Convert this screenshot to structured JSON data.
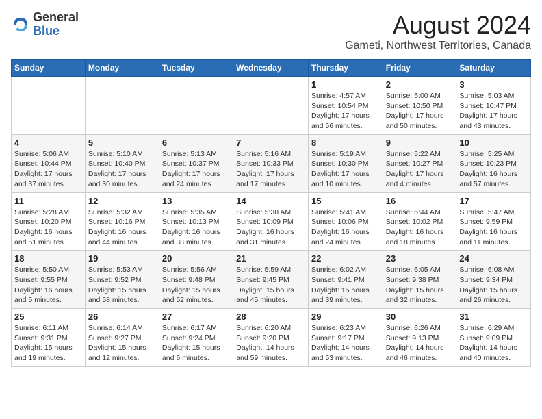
{
  "logo": {
    "general": "General",
    "blue": "Blue"
  },
  "title": {
    "month_year": "August 2024",
    "location": "Gameti, Northwest Territories, Canada"
  },
  "days_of_week": [
    "Sunday",
    "Monday",
    "Tuesday",
    "Wednesday",
    "Thursday",
    "Friday",
    "Saturday"
  ],
  "weeks": [
    [
      {
        "day": "",
        "info": ""
      },
      {
        "day": "",
        "info": ""
      },
      {
        "day": "",
        "info": ""
      },
      {
        "day": "",
        "info": ""
      },
      {
        "day": "1",
        "info": "Sunrise: 4:57 AM\nSunset: 10:54 PM\nDaylight: 17 hours\nand 56 minutes."
      },
      {
        "day": "2",
        "info": "Sunrise: 5:00 AM\nSunset: 10:50 PM\nDaylight: 17 hours\nand 50 minutes."
      },
      {
        "day": "3",
        "info": "Sunrise: 5:03 AM\nSunset: 10:47 PM\nDaylight: 17 hours\nand 43 minutes."
      }
    ],
    [
      {
        "day": "4",
        "info": "Sunrise: 5:06 AM\nSunset: 10:44 PM\nDaylight: 17 hours\nand 37 minutes."
      },
      {
        "day": "5",
        "info": "Sunrise: 5:10 AM\nSunset: 10:40 PM\nDaylight: 17 hours\nand 30 minutes."
      },
      {
        "day": "6",
        "info": "Sunrise: 5:13 AM\nSunset: 10:37 PM\nDaylight: 17 hours\nand 24 minutes."
      },
      {
        "day": "7",
        "info": "Sunrise: 5:16 AM\nSunset: 10:33 PM\nDaylight: 17 hours\nand 17 minutes."
      },
      {
        "day": "8",
        "info": "Sunrise: 5:19 AM\nSunset: 10:30 PM\nDaylight: 17 hours\nand 10 minutes."
      },
      {
        "day": "9",
        "info": "Sunrise: 5:22 AM\nSunset: 10:27 PM\nDaylight: 17 hours\nand 4 minutes."
      },
      {
        "day": "10",
        "info": "Sunrise: 5:25 AM\nSunset: 10:23 PM\nDaylight: 16 hours\nand 57 minutes."
      }
    ],
    [
      {
        "day": "11",
        "info": "Sunrise: 5:28 AM\nSunset: 10:20 PM\nDaylight: 16 hours\nand 51 minutes."
      },
      {
        "day": "12",
        "info": "Sunrise: 5:32 AM\nSunset: 10:16 PM\nDaylight: 16 hours\nand 44 minutes."
      },
      {
        "day": "13",
        "info": "Sunrise: 5:35 AM\nSunset: 10:13 PM\nDaylight: 16 hours\nand 38 minutes."
      },
      {
        "day": "14",
        "info": "Sunrise: 5:38 AM\nSunset: 10:09 PM\nDaylight: 16 hours\nand 31 minutes."
      },
      {
        "day": "15",
        "info": "Sunrise: 5:41 AM\nSunset: 10:06 PM\nDaylight: 16 hours\nand 24 minutes."
      },
      {
        "day": "16",
        "info": "Sunrise: 5:44 AM\nSunset: 10:02 PM\nDaylight: 16 hours\nand 18 minutes."
      },
      {
        "day": "17",
        "info": "Sunrise: 5:47 AM\nSunset: 9:59 PM\nDaylight: 16 hours\nand 11 minutes."
      }
    ],
    [
      {
        "day": "18",
        "info": "Sunrise: 5:50 AM\nSunset: 9:55 PM\nDaylight: 16 hours\nand 5 minutes."
      },
      {
        "day": "19",
        "info": "Sunrise: 5:53 AM\nSunset: 9:52 PM\nDaylight: 15 hours\nand 58 minutes."
      },
      {
        "day": "20",
        "info": "Sunrise: 5:56 AM\nSunset: 9:48 PM\nDaylight: 15 hours\nand 52 minutes."
      },
      {
        "day": "21",
        "info": "Sunrise: 5:59 AM\nSunset: 9:45 PM\nDaylight: 15 hours\nand 45 minutes."
      },
      {
        "day": "22",
        "info": "Sunrise: 6:02 AM\nSunset: 9:41 PM\nDaylight: 15 hours\nand 39 minutes."
      },
      {
        "day": "23",
        "info": "Sunrise: 6:05 AM\nSunset: 9:38 PM\nDaylight: 15 hours\nand 32 minutes."
      },
      {
        "day": "24",
        "info": "Sunrise: 6:08 AM\nSunset: 9:34 PM\nDaylight: 15 hours\nand 26 minutes."
      }
    ],
    [
      {
        "day": "25",
        "info": "Sunrise: 6:11 AM\nSunset: 9:31 PM\nDaylight: 15 hours\nand 19 minutes."
      },
      {
        "day": "26",
        "info": "Sunrise: 6:14 AM\nSunset: 9:27 PM\nDaylight: 15 hours\nand 12 minutes."
      },
      {
        "day": "27",
        "info": "Sunrise: 6:17 AM\nSunset: 9:24 PM\nDaylight: 15 hours\nand 6 minutes."
      },
      {
        "day": "28",
        "info": "Sunrise: 6:20 AM\nSunset: 9:20 PM\nDaylight: 14 hours\nand 59 minutes."
      },
      {
        "day": "29",
        "info": "Sunrise: 6:23 AM\nSunset: 9:17 PM\nDaylight: 14 hours\nand 53 minutes."
      },
      {
        "day": "30",
        "info": "Sunrise: 6:26 AM\nSunset: 9:13 PM\nDaylight: 14 hours\nand 46 minutes."
      },
      {
        "day": "31",
        "info": "Sunrise: 6:29 AM\nSunset: 9:09 PM\nDaylight: 14 hours\nand 40 minutes."
      }
    ]
  ]
}
